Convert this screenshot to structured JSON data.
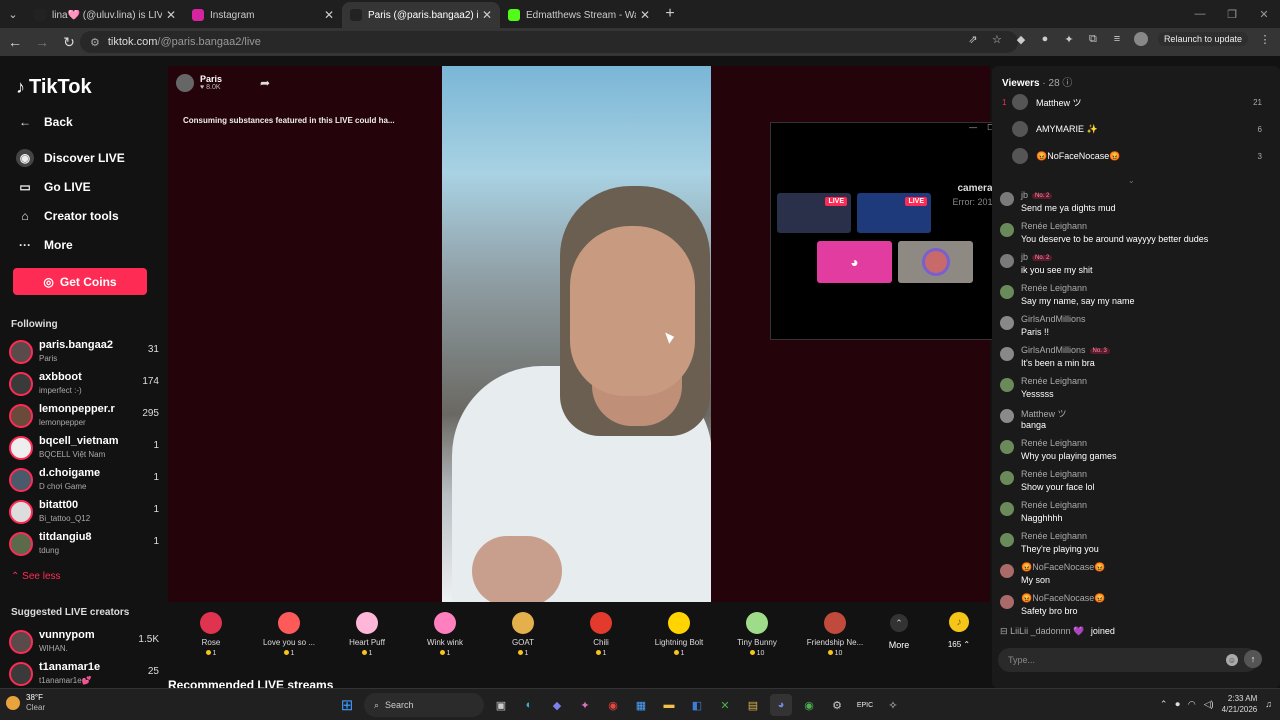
{
  "browser": {
    "tabs": [
      {
        "title": "lina🩷 (@uluv.lina) is LIVE - TikTok",
        "color": "#222222",
        "active": false
      },
      {
        "title": "Instagram",
        "color": "#d6249f",
        "active": false
      },
      {
        "title": "Paris (@paris.bangaa2) is LIVE",
        "color": "#222222",
        "active": true
      },
      {
        "title": "Edmatthews Stream - Watch Live",
        "color": "#53fc18",
        "active": false
      }
    ],
    "url_host": "tiktok.com",
    "url_path": "/@paris.bangaa2/live",
    "relaunch_label": "Relaunch to update"
  },
  "sidebar": {
    "logo": "TikTok",
    "back": "Back",
    "nav": [
      {
        "label": "Discover LIVE",
        "icon": "discover-icon"
      },
      {
        "label": "Go LIVE",
        "icon": "camera-icon"
      },
      {
        "label": "Creator tools",
        "icon": "home-icon"
      },
      {
        "label": "More",
        "icon": "more-icon"
      }
    ],
    "coins_label": "Get Coins",
    "following_title": "Following",
    "following": [
      {
        "name": "paris.bangaa2",
        "sub": "Paris",
        "count": "31"
      },
      {
        "name": "axbboot",
        "sub": "imperfect :-)",
        "count": "174"
      },
      {
        "name": "lemonpepper.r",
        "sub": "lemonpepper",
        "count": "295"
      },
      {
        "name": "bqcell_vietnam",
        "sub": "BQCELL Việt Nam",
        "count": "1"
      },
      {
        "name": "d.choigame",
        "sub": "D chơi Game",
        "count": "1"
      },
      {
        "name": "bitatt00",
        "sub": "Bi_tattoo_Q12",
        "count": "1"
      },
      {
        "name": "titdangiu8",
        "sub": "tdung",
        "count": "1"
      }
    ],
    "see_less": "See less",
    "suggested_title": "Suggested LIVE creators",
    "suggested": [
      {
        "name": "vunnypom",
        "sub": "WIHAN.",
        "count": "1.5K"
      },
      {
        "name": "t1anamar1e",
        "sub": "t1anamar1e💕",
        "count": "25"
      }
    ]
  },
  "stream": {
    "streamer": "Paris",
    "likes": "8.0K",
    "warning": "Consuming substances featured in this LIVE could ha...",
    "recommended": "Recommended LIVE streams",
    "gifts": [
      {
        "name": "Rose",
        "price": "1",
        "color": "#e0334f"
      },
      {
        "name": "Love you so ...",
        "price": "1",
        "color": "#ff5a5a"
      },
      {
        "name": "Heart Puff",
        "price": "1",
        "color": "#ffb6d9"
      },
      {
        "name": "Wink wink",
        "price": "1",
        "color": "#ff7fbf"
      },
      {
        "name": "GOAT",
        "price": "1",
        "color": "#e3b04b"
      },
      {
        "name": "Chili",
        "price": "1",
        "color": "#e23b2e"
      },
      {
        "name": "Lightning Bolt",
        "price": "1",
        "color": "#ffd400"
      },
      {
        "name": "Tiny Bunny",
        "price": "10",
        "color": "#9fdc8a"
      },
      {
        "name": "Friendship Ne...",
        "price": "10",
        "color": "#c04a3c"
      }
    ],
    "more_label": "More",
    "coin_balance": "165"
  },
  "popup": {
    "camera_label": "camera",
    "camera_error": "Error: 2012",
    "live_tag": "LIVE"
  },
  "chat": {
    "viewers_label": "Viewers",
    "viewers_count": "28",
    "top_viewers": [
      {
        "rank": "1",
        "name": "Matthew ツ",
        "score": "21"
      },
      {
        "rank": "",
        "name": "AMYMARIE ✨",
        "score": "6"
      },
      {
        "rank": "",
        "name": "😡NoFaceNocase😡",
        "score": "3"
      }
    ],
    "messages": [
      {
        "user": "jb",
        "badge": "No. 2",
        "text": "Send me ya dights mud",
        "color": "#7a7a7a"
      },
      {
        "user": "Renée Leighann",
        "badge": "",
        "text": "You deserve to be around wayyyy better dudes",
        "color": "#6a8a5a"
      },
      {
        "user": "jb",
        "badge": "No. 2",
        "text": "ik you see my shit",
        "color": "#7a7a7a"
      },
      {
        "user": "Renée Leighann",
        "badge": "",
        "text": "Say my name, say my name",
        "color": "#6a8a5a"
      },
      {
        "user": "GirlsAndMillions",
        "badge": "",
        "text": "Paris !!",
        "color": "#888888"
      },
      {
        "user": "GirlsAndMillions",
        "badge": "No. 3",
        "text": "It's been a min bra",
        "color": "#888888"
      },
      {
        "user": "Renée Leighann",
        "badge": "",
        "text": "Yesssss",
        "color": "#6a8a5a"
      },
      {
        "user": "Matthew ツ",
        "badge": "",
        "text": "banga",
        "color": "#8a8a8a"
      },
      {
        "user": "Renée Leighann",
        "badge": "",
        "text": "Why you playing games",
        "color": "#6a8a5a"
      },
      {
        "user": "Renée Leighann",
        "badge": "",
        "text": "Show your face lol",
        "color": "#6a8a5a"
      },
      {
        "user": "Renée Leighann",
        "badge": "",
        "text": "Nagghhhh",
        "color": "#6a8a5a"
      },
      {
        "user": "Renée Leighann",
        "badge": "",
        "text": "They're playing you",
        "color": "#6a8a5a"
      },
      {
        "user": "😡NoFaceNocase😡",
        "badge": "",
        "text": "My son",
        "color": "#aa6a6a"
      },
      {
        "user": "😡NoFaceNocase😡",
        "badge": "",
        "text": "Safety bro bro",
        "color": "#aa6a6a"
      }
    ],
    "joined_user": "LiiLii _dadonnn 💜",
    "joined_text": "joined",
    "input_placeholder": "Type..."
  },
  "taskbar": {
    "temp": "38°F",
    "weather": "Clear",
    "search": "Search",
    "time": "2:33 AM",
    "date": "4/21/2026"
  }
}
